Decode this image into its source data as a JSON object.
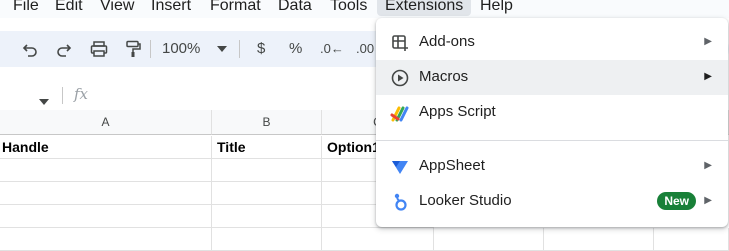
{
  "menubar": {
    "items": [
      "File",
      "Edit",
      "View",
      "Insert",
      "Format",
      "Data",
      "Tools",
      "Extensions",
      "Help"
    ],
    "active": "Extensions"
  },
  "toolbar": {
    "undo_icon": "undo-icon",
    "redo_icon": "redo-icon",
    "print_icon": "print-icon",
    "paint_format_icon": "paint-format-icon",
    "zoom": "100%",
    "currency": "$",
    "percent": "%",
    "decrease_decimal": ".0←",
    "increase_decimal": ".00"
  },
  "formula_bar": {
    "fx": "fx"
  },
  "grid": {
    "columns": [
      "A",
      "B",
      "C"
    ],
    "header_row": [
      "Handle",
      "Title",
      "Option1"
    ]
  },
  "extensions_menu": {
    "items": [
      {
        "label": "Add-ons",
        "icon": "add-ons-icon",
        "submenu": true
      },
      {
        "label": "Macros",
        "icon": "macros-play-icon",
        "submenu": true,
        "highlighted": true
      },
      {
        "label": "Apps Script",
        "icon": "apps-script-icon",
        "submenu": false
      },
      {
        "label": "AppSheet",
        "icon": "appsheet-icon",
        "submenu": true
      },
      {
        "label": "Looker Studio",
        "icon": "looker-studio-icon",
        "submenu": true,
        "badge": "New"
      }
    ]
  },
  "colors": {
    "toolbar_bg": "#edf2fa",
    "badge_green": "#188038",
    "appsheet_blue": "#4285f4",
    "hover_bg": "#eef0f2"
  }
}
